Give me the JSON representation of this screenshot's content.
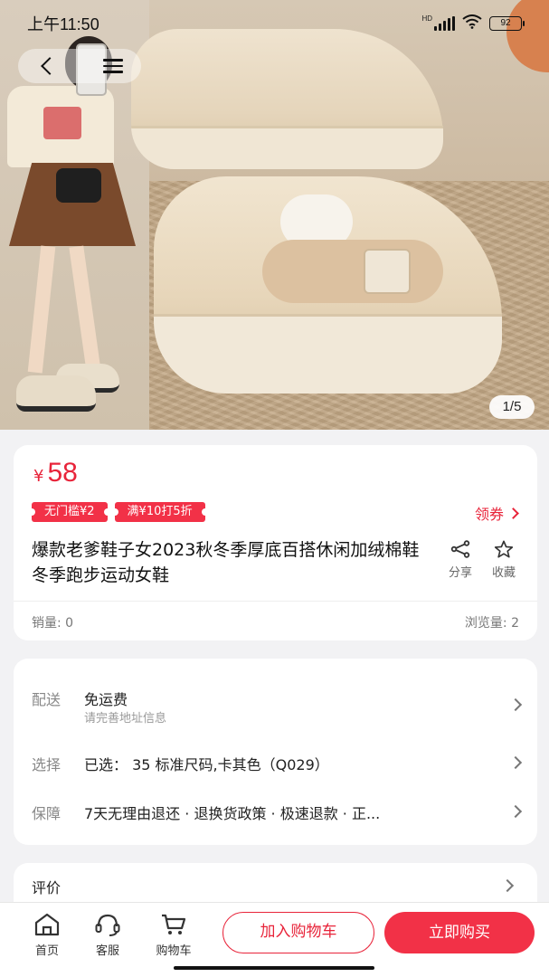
{
  "status_bar": {
    "time": "上午11:50",
    "network_label": "HD",
    "battery": "92"
  },
  "gallery": {
    "page_indicator": "1/5",
    "colors": {
      "accent": "#e8243a",
      "coupon_bg": "#f23147"
    }
  },
  "product": {
    "currency": "¥",
    "price": "58",
    "coupons": [
      "无门槛¥2",
      "满¥10打5折"
    ],
    "get_coupon": "领券",
    "title": "爆款老爹鞋子女2023秋冬季厚底百搭休闲加绒棉鞋冬季跑步运动女鞋",
    "share": "分享",
    "favorite": "收藏",
    "sales": "销量: 0",
    "views": "浏览量: 2"
  },
  "info": {
    "delivery": {
      "label": "配送",
      "value": "免运费",
      "sub": "请完善地址信息"
    },
    "select": {
      "label": "选择",
      "value": "已选： 35 标准尺码,卡其色（Q029）"
    },
    "guarantee": {
      "label": "保障",
      "value": "7天无理由退还 · 退换货政策 · 极速退款 · 正..."
    }
  },
  "review": {
    "label": "评价"
  },
  "bottom_bar": {
    "home": "首页",
    "service": "客服",
    "cart": "购物车",
    "add_to_cart": "加入购物车",
    "buy_now": "立即购买"
  }
}
